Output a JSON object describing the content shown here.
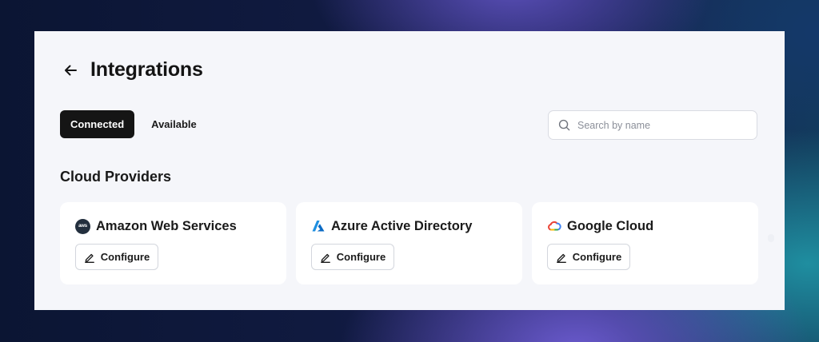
{
  "header": {
    "title": "Integrations"
  },
  "tabs": [
    {
      "label": "Connected",
      "active": true
    },
    {
      "label": "Available",
      "active": false
    }
  ],
  "search": {
    "placeholder": "Search by name",
    "value": ""
  },
  "section": {
    "title": "Cloud Providers"
  },
  "providers": [
    {
      "name": "Amazon Web Services",
      "icon": "aws-logo-icon",
      "logo_text": "aws",
      "button": "Configure"
    },
    {
      "name": "Azure Active Directory",
      "icon": "azure-logo-icon",
      "button": "Configure"
    },
    {
      "name": "Google Cloud",
      "icon": "google-cloud-logo-icon",
      "button": "Configure"
    }
  ],
  "colors": {
    "active_tab_bg": "#151515",
    "panel_bg": "#f5f6fa",
    "azure_blue": "#0a7bd6",
    "aws_dark": "#232f3e"
  }
}
